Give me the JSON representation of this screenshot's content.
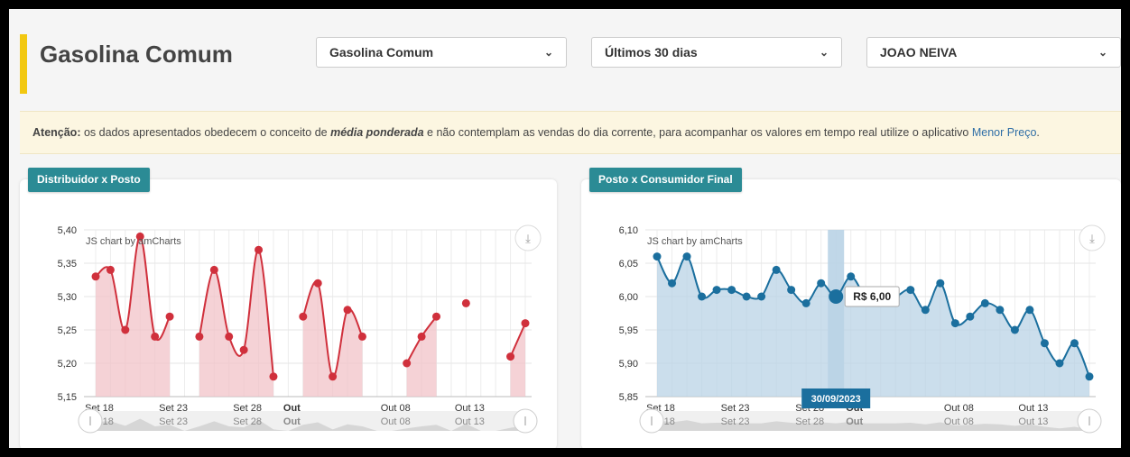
{
  "page": {
    "title": "Gasolina Comum",
    "selects": [
      {
        "value": "Gasolina Comum"
      },
      {
        "value": "Últimos 30 dias"
      },
      {
        "value": "JOAO NEIVA"
      }
    ]
  },
  "notice": {
    "label": "Atenção:",
    "text1": " os dados apresentados obedecem o conceito de ",
    "emphasis": "média ponderada",
    "text2": " e não contemplam as vendas do dia corrente, para acompanhar os valores em tempo real utilize o aplicativo ",
    "link": "Menor Preço",
    "end": "."
  },
  "panels": {
    "left_tag": "Distribuidor x Posto",
    "right_tag": "Posto x Consumidor Final",
    "credit": "JS chart by amCharts"
  },
  "colors": {
    "accent": "#f2c811",
    "tag": "#2b8b95",
    "left_series": "#d0303c",
    "left_fill": "#f2c3c8",
    "right_series": "#1b6f9e",
    "right_fill": "#b9d3e6"
  },
  "chart_data": [
    {
      "type": "area",
      "title": "Distribuidor x Posto",
      "ylim": [
        5.15,
        5.4
      ],
      "y_ticks": [
        "5,40",
        "5,35",
        "5,30",
        "5,25",
        "5,20",
        "5,15"
      ],
      "x_ticks": [
        "Set 18",
        "Set 23",
        "Set 28",
        "Out",
        "Out 08",
        "Out 13"
      ],
      "scrollbar_ticks": [
        "Set 18",
        "Set 23",
        "Set 28",
        "Out",
        "Out 08",
        "Out 13"
      ],
      "x_start": "2023-09-18",
      "series": [
        {
          "values": [
            5.33,
            5.34,
            5.25,
            5.39,
            5.24,
            5.27,
            null,
            5.24,
            5.34,
            5.24,
            5.22,
            5.37,
            5.18,
            null,
            5.27,
            5.32,
            5.18,
            5.28,
            5.24,
            null,
            null,
            5.2,
            5.24,
            5.27,
            null,
            5.29,
            null,
            null,
            5.21,
            5.26
          ]
        }
      ]
    },
    {
      "type": "area",
      "title": "Posto x Consumidor Final",
      "ylim": [
        5.85,
        6.1
      ],
      "y_ticks": [
        "6,10",
        "6,05",
        "6,00",
        "5,95",
        "5,90",
        "5,85"
      ],
      "x_ticks": [
        "Set 18",
        "Set 23",
        "Set 28",
        "Out",
        "Out 08",
        "Out 13"
      ],
      "scrollbar_ticks": [
        "Set 18",
        "Set 23",
        "Set 28",
        "Out",
        "Out 08",
        "Out 13"
      ],
      "x_start": "2023-09-18",
      "cursor": {
        "date_label": "30/09/2023",
        "value_label": "R$ 6,00"
      },
      "series": [
        {
          "values": [
            6.06,
            6.02,
            6.06,
            6.0,
            6.01,
            6.01,
            6.0,
            6.0,
            6.04,
            6.01,
            5.99,
            6.02,
            6.0,
            6.03,
            6.0,
            6.0,
            6.0,
            6.01,
            5.98,
            6.02,
            5.96,
            5.97,
            5.99,
            5.98,
            5.95,
            5.98,
            5.93,
            5.9,
            5.93,
            5.88
          ]
        }
      ]
    }
  ]
}
